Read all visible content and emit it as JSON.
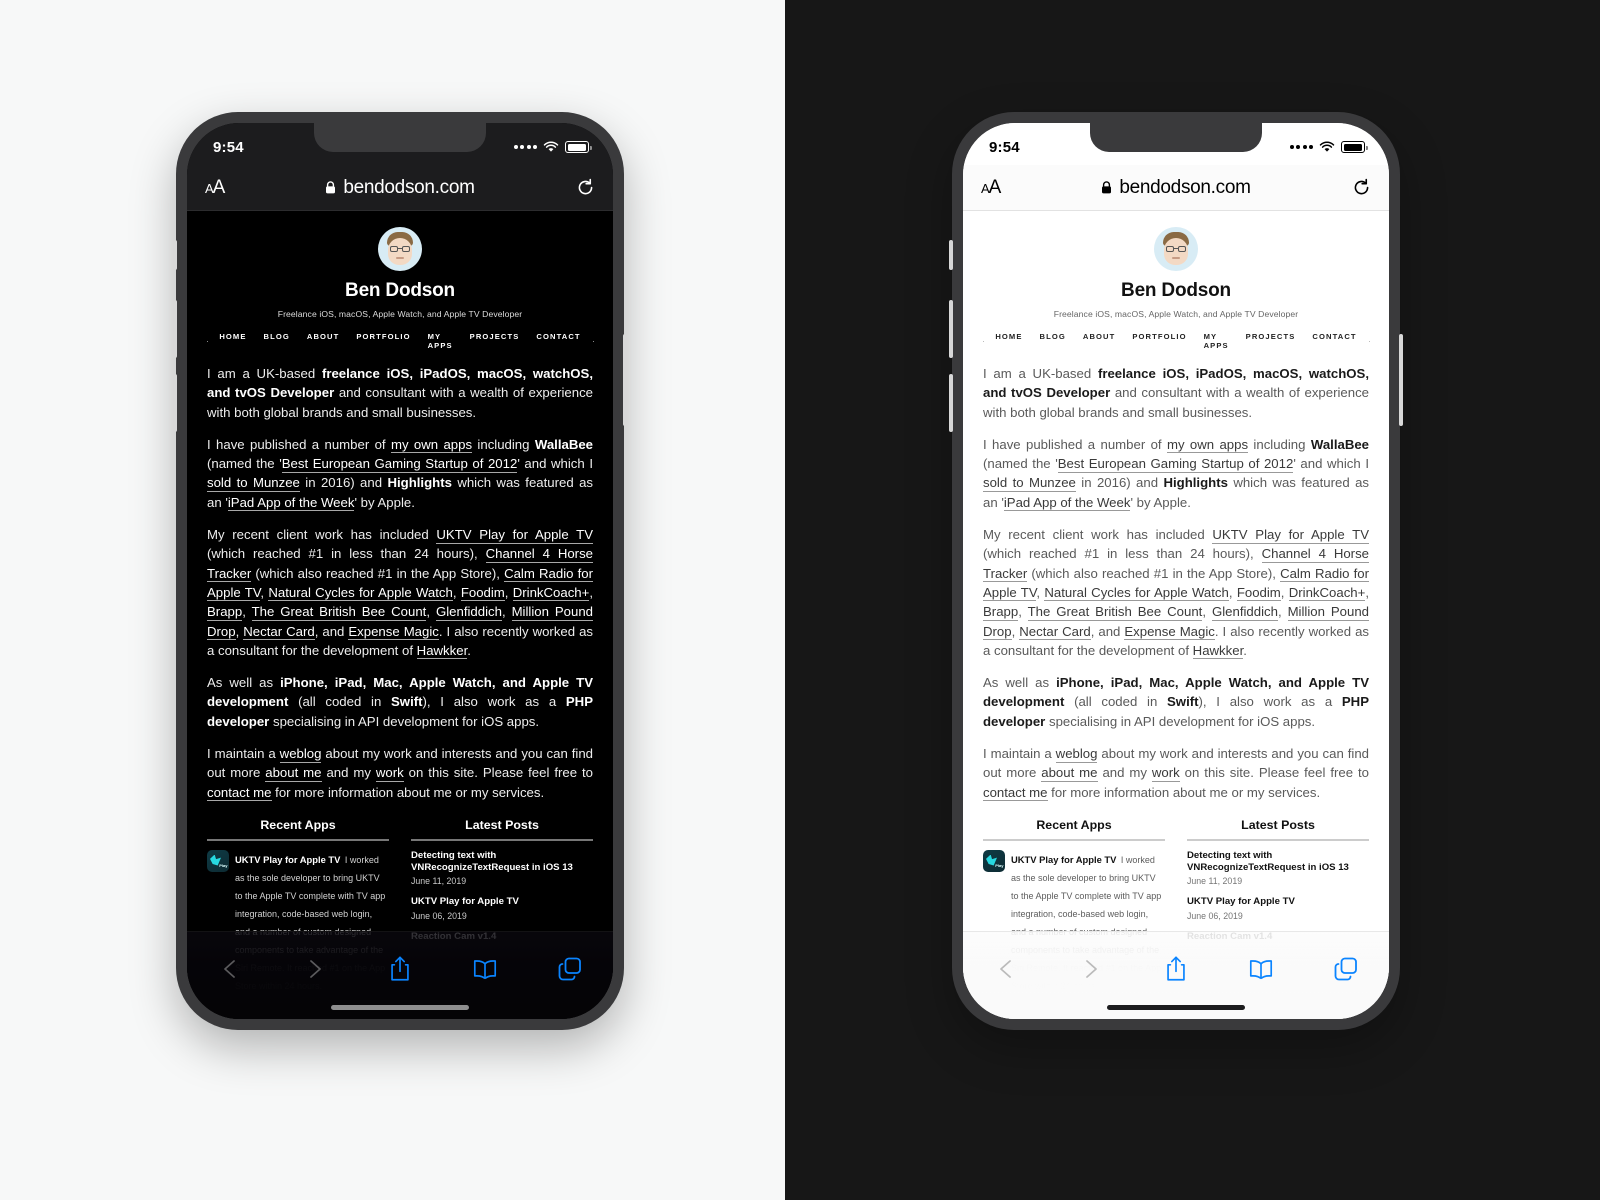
{
  "canvas": {
    "left_background": "#f7f8f8",
    "right_background": "#171717"
  },
  "phones": [
    {
      "id": "dark",
      "appearance": "dark-mode"
    },
    {
      "id": "light",
      "appearance": "light-mode"
    }
  ],
  "status_bar": {
    "time": "9:54",
    "signal_icon": "cellular-dots-icon",
    "wifi_icon": "wifi-icon",
    "battery_icon": "battery-full-icon"
  },
  "browser": {
    "text_size_label_small": "A",
    "text_size_label_large": "A",
    "lock_icon": "lock-icon",
    "url": "bendodson.com",
    "reload_icon": "reload-icon",
    "toolbar": {
      "back_icon": "chevron-left-icon",
      "forward_icon": "chevron-right-icon",
      "share_icon": "share-icon",
      "bookmarks_icon": "book-icon",
      "tabs_icon": "tabs-icon"
    }
  },
  "site": {
    "avatar_alt": "avatar",
    "name": "Ben Dodson",
    "tagline": "Freelance iOS, macOS, Apple Watch, and Apple TV Developer",
    "nav": [
      {
        "label": "HOME"
      },
      {
        "label": "BLOG"
      },
      {
        "label": "ABOUT"
      },
      {
        "label": "PORTFOLIO"
      },
      {
        "label": "MY APPS"
      },
      {
        "label": "PROJECTS"
      },
      {
        "label": "CONTACT"
      }
    ],
    "paragraphs": {
      "p1_a": "I am a UK-based ",
      "p1_b": "freelance iOS, iPadOS, macOS, watchOS, and tvOS Developer",
      "p1_c": " and consultant with a wealth of experience with both global brands and small businesses.",
      "p2_a": "I have published a number of ",
      "p2_link1": "my own apps",
      "p2_b": " including ",
      "p2_bold1": "WallaBee",
      "p2_c": " (named the '",
      "p2_link2": "Best European Gaming Startup of 2012",
      "p2_d": "' and which I ",
      "p2_link3": "sold to Munzee",
      "p2_e": " in 2016) and ",
      "p2_bold2": "Highlights",
      "p2_f": " which was featured as an '",
      "p2_link4": "iPad App of the Week",
      "p2_g": "' by Apple.",
      "p3_a": "My recent client work has included ",
      "p3_link1": "UKTV Play for Apple TV",
      "p3_b": " (which reached #1 in less than 24 hours), ",
      "p3_link2": "Channel 4 Horse Tracker",
      "p3_c": " (which also reached #1 in the App Store), ",
      "p3_link3": "Calm Radio for Apple TV",
      "p3_d": ", ",
      "p3_link4": "Natural Cycles for Apple Watch",
      "p3_e": ", ",
      "p3_link5": "Foodim",
      "p3_f": ", ",
      "p3_link6": "DrinkCoach+",
      "p3_g": ", ",
      "p3_link7": "Brapp",
      "p3_h": ", ",
      "p3_link8": "The Great British Bee Count",
      "p3_i": ", ",
      "p3_link9": "Glenfiddich",
      "p3_j": ", ",
      "p3_link10": "Million Pound Drop",
      "p3_k": ", ",
      "p3_link11": "Nectar Card",
      "p3_l": ", and ",
      "p3_link12": "Expense Magic",
      "p3_m": ". I also recently worked as a consultant for the development of ",
      "p3_link13": "Hawkker",
      "p3_n": ".",
      "p4_a": "As well as ",
      "p4_bold1": "iPhone, iPad, Mac, Apple Watch, and Apple TV development",
      "p4_b": " (all coded in ",
      "p4_bold2": "Swift",
      "p4_c": "), I also work as a ",
      "p4_bold3": "PHP developer",
      "p4_d": " specialising in API development for iOS apps.",
      "p5_a": "I maintain a ",
      "p5_link1": "weblog",
      "p5_b": " about my work and interests and you can find out more ",
      "p5_link2": "about me",
      "p5_c": " and my ",
      "p5_link3": "work",
      "p5_d": " on this site. Please feel free to ",
      "p5_link4": "contact me",
      "p5_e": " for more information about me or my services."
    },
    "recent_apps": {
      "heading": "Recent Apps",
      "item_title": "UKTV Play for Apple TV",
      "item_desc": "I worked as the sole developer to bring UKTV to the Apple TV complete with TV app integration, code-based web login, and a number of custom designed components to take advantage of the Siri Remote. It reached #1 on the App Store within 24 hours."
    },
    "latest_posts": {
      "heading": "Latest Posts",
      "items": [
        {
          "title": "Detecting text with VNRecognizeTextRequest in iOS 13",
          "date": "June 11, 2019"
        },
        {
          "title": "UKTV Play for Apple TV",
          "date": "June 06, 2019"
        },
        {
          "title": "Reaction Cam v1.4",
          "date": ""
        }
      ]
    }
  },
  "colors": {
    "accent_blue": "#0a84ff",
    "dark_page_bg": "#000000",
    "light_page_bg": "#ffffff",
    "phone_frame": "#3a3a3c"
  }
}
